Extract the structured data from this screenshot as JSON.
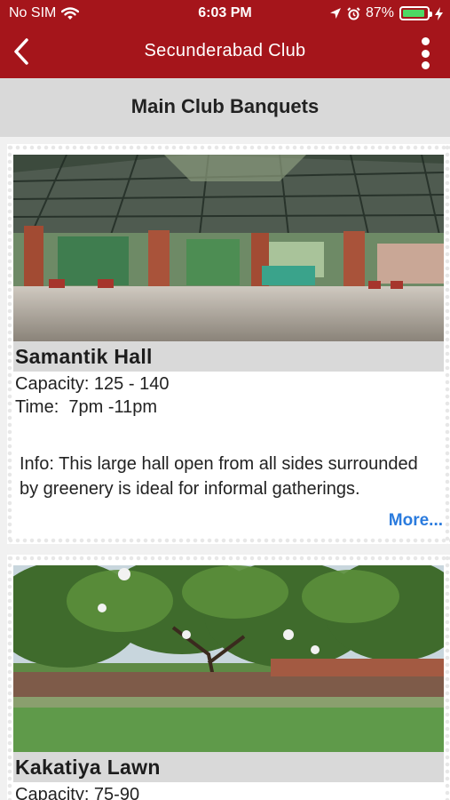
{
  "status_bar": {
    "carrier": "No SIM",
    "time": "6:03 PM",
    "battery_percent": "87%",
    "battery_level": 0.87
  },
  "nav": {
    "title": "Secunderabad Club",
    "back_icon": "chevron-left-icon",
    "more_icon": "vertical-ellipsis-icon"
  },
  "section": {
    "title": "Main Club Banquets"
  },
  "venues": [
    {
      "name": "Samantik Hall",
      "capacity": "Capacity: 125 - 140",
      "time": "Time:  7pm -11pm",
      "info": "Info: This large hall open from all sides surrounded by greenery is ideal for informal gatherings.",
      "more_label": "More..."
    },
    {
      "name": "Kakatiya Lawn",
      "capacity": "Capacity: 75-90"
    }
  ],
  "colors": {
    "brand_red": "#a5151b",
    "header_gray": "#d9d9d9",
    "link_blue": "#2a7bde",
    "battery_green": "#4cd964"
  }
}
